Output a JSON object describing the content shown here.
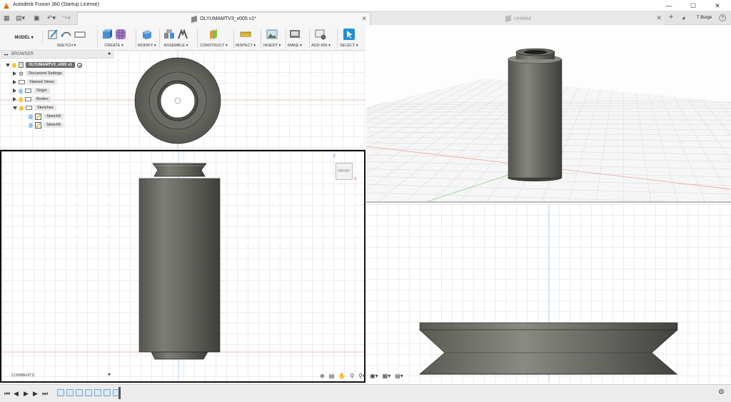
{
  "window": {
    "title": "Autodesk Fusion 360 (Startup License)",
    "minimize": "—",
    "maximize": "☐",
    "close": "✕"
  },
  "tabs": {
    "active_label": "OLYUMAMTV3_v005 v1*",
    "untitled_label": "Untitled",
    "add": "+",
    "close": "✕",
    "user": "T Burge",
    "help": "?"
  },
  "toolbar": {
    "workspace": "MODEL ▾",
    "groups": {
      "sketch": "SKETCH ▾",
      "create": "CREATE ▾",
      "modify": "MODIFY ▾",
      "assemble": "ASSEMBLE ▾",
      "construct": "CONSTRUCT ▾",
      "inspect": "INSPECT ▾",
      "insert": "INSERT ▾",
      "make": "MAKE ▾",
      "addins": "ADD-INS ▾",
      "select": "SELECT ▾"
    }
  },
  "browser": {
    "header": "BROWSER",
    "root": "OLYUMAMTV3_v005 v1",
    "items": {
      "doc_settings": "Document Settings",
      "named_views": "Named Views",
      "origin": "Origin",
      "bodies": "Bodies",
      "sketches": "Sketches",
      "sketch4": "Sketch4",
      "sketch5": "Sketch5"
    }
  },
  "viewcube": {
    "face": "FRONT",
    "axis_z": "Z",
    "axis_x": "X"
  },
  "comments": "COMMENTS",
  "colors": {
    "accent": "#1f8fd6",
    "metal": "#6b6b66",
    "selection": "#111111"
  }
}
